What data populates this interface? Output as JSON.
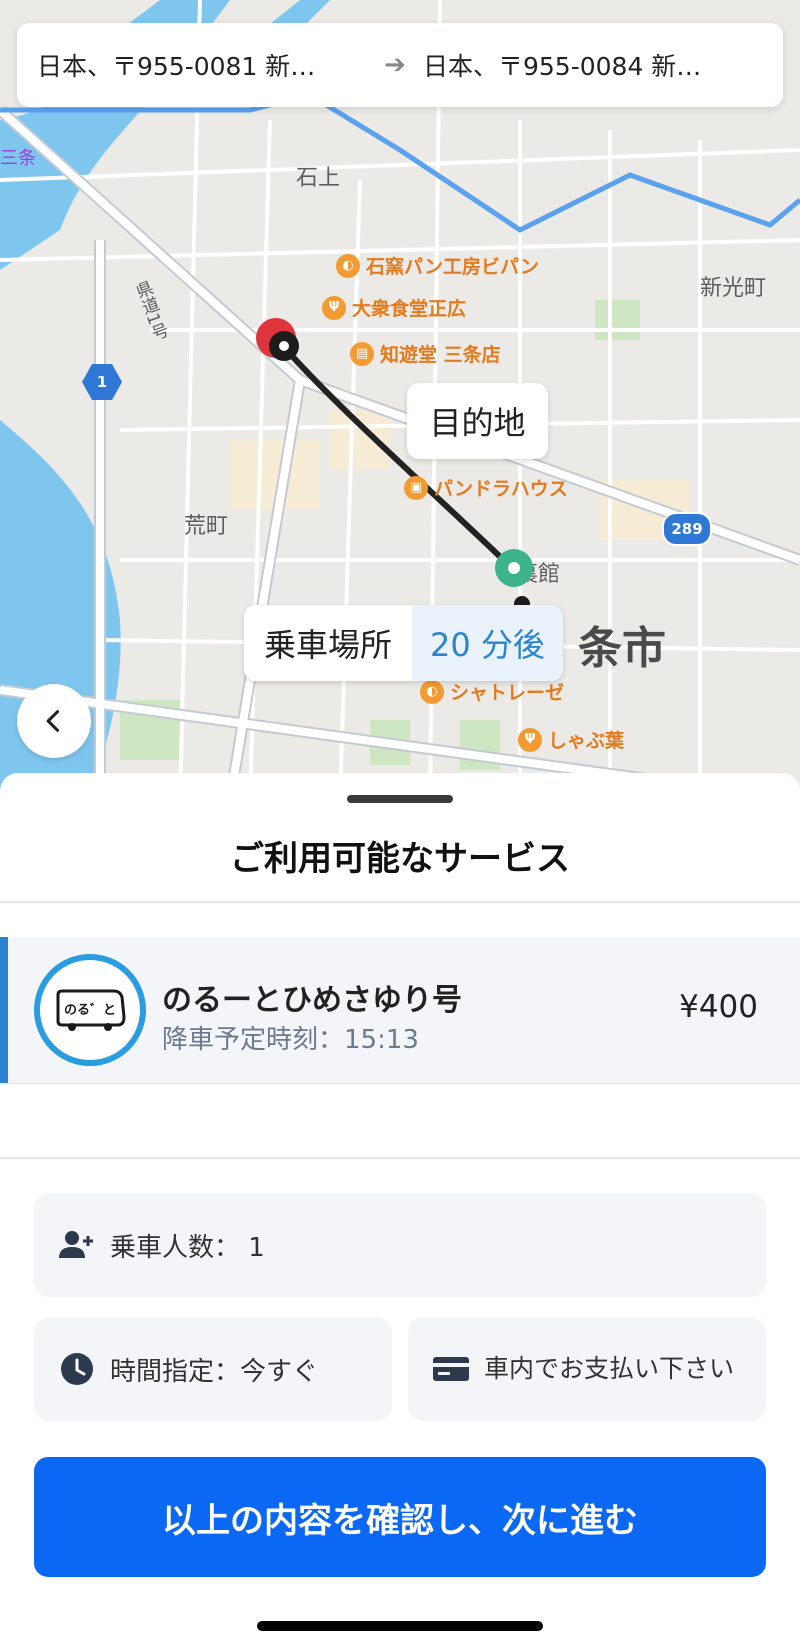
{
  "route": {
    "origin": "日本、〒955-0081 新…",
    "destination": "日本、〒955-0084 新…"
  },
  "map": {
    "labels": {
      "ishigami": "石上",
      "shinko": "新光町",
      "aramachi": "荒町",
      "sanjo_city": "条市",
      "sanjo_small": "三条",
      "kendo": "県道1号",
      "yakata": "裏館"
    },
    "pois": {
      "bakery": "石窯パン工房ビパン",
      "restaurant": "大衆食堂正広",
      "bookstore": "知遊堂 三条店",
      "pandora": "パンドラハウス",
      "chateraise": "シャトレーゼ",
      "shabu": "しゃぶ葉"
    },
    "route_shields": {
      "r1": "1",
      "r289": "289"
    },
    "destination_callout": "目的地",
    "pickup_callout": {
      "label": "乗車場所",
      "eta": "20 分後"
    }
  },
  "sheet": {
    "title": "ご利用可能なサービス",
    "service": {
      "logo_text": "のる゛と",
      "name": "のるーとひめさゆり号",
      "dropoff_time": "降車予定時刻：15:13",
      "price": "¥400"
    },
    "options": {
      "passengers": "乗車人数： 1",
      "time": "時間指定：今すぐ",
      "payment": "車内でお支払い下さい"
    },
    "confirm_label": "以上の内容を確認し、次に進む"
  },
  "colors": {
    "accent_blue": "#0a68f5",
    "service_blue": "#2a84d2",
    "dest_red": "#e0343c",
    "pickup_green": "#3cb38b"
  },
  "icons": {
    "back": "chevron-left-icon",
    "arrow": "arrow-right-icon",
    "passengers": "person-add-icon",
    "time": "clock-icon",
    "payment": "credit-card-icon"
  }
}
